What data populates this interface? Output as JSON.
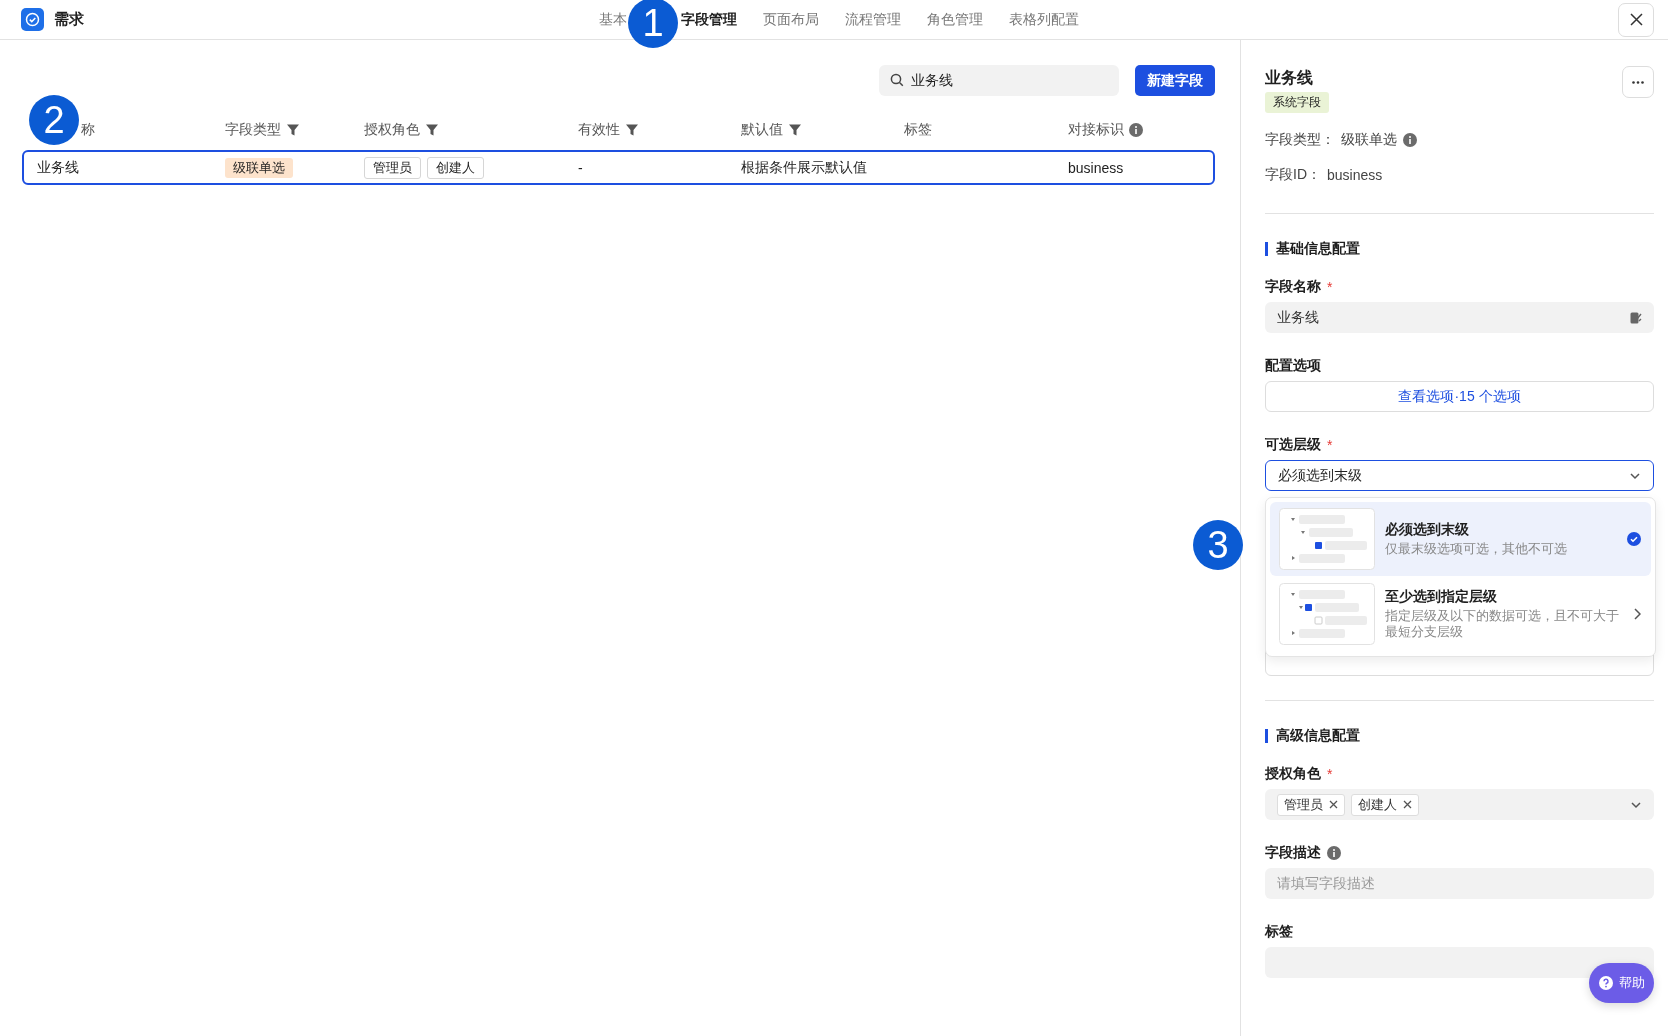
{
  "app": {
    "title": "需求"
  },
  "tabs": [
    {
      "label": "基本",
      "selected": false
    },
    {
      "label": "字段管理",
      "selected": true
    },
    {
      "label": "页面布局",
      "selected": false
    },
    {
      "label": "流程管理",
      "selected": false
    },
    {
      "label": "角色管理",
      "selected": false
    },
    {
      "label": "表格列配置",
      "selected": false
    }
  ],
  "annotations": [
    "1",
    "2",
    "3"
  ],
  "search": {
    "value": "业务线"
  },
  "new_button": "新建字段",
  "table": {
    "columns": [
      {
        "label": "称",
        "kind": "plain"
      },
      {
        "label": "字段类型",
        "kind": "filter"
      },
      {
        "label": "授权角色",
        "kind": "filter"
      },
      {
        "label": "有效性",
        "kind": "filter"
      },
      {
        "label": "默认值",
        "kind": "filter"
      },
      {
        "label": "标签",
        "kind": "plain"
      },
      {
        "label": "对接标识",
        "kind": "info"
      }
    ],
    "rows": [
      {
        "name": "业务线",
        "type": "级联单选",
        "roles": [
          "管理员",
          "创建人"
        ],
        "validity": "-",
        "default": "根据条件展示默认值",
        "key": "business",
        "selected": true
      }
    ]
  },
  "detail": {
    "title": "业务线",
    "badge": "系统字段",
    "type_label": "字段类型：",
    "type_value": "级联单选",
    "id_label": "字段ID：",
    "id_value": "business",
    "basic_section": "基础信息配置",
    "name_label": "字段名称",
    "name_required_mark": "*",
    "name_value": "业务线",
    "options_label": "配置选项",
    "options_button": "查看选项·15 个选项",
    "level_label": "可选层级",
    "level_required_mark": "*",
    "level_value": "必须选到末级",
    "level_options": [
      {
        "title": "必须选到末级",
        "desc": "仅最末级选项可选，其他不可选",
        "selected": true,
        "expandable": false
      },
      {
        "title": "至少选到指定层级",
        "desc": "指定层级及以下的数据可选，且不可大于最短分支层级",
        "selected": false,
        "expandable": true
      }
    ],
    "advanced_section": "高级信息配置",
    "roles_label": "授权角色",
    "roles_required_mark": "*",
    "roles": [
      "管理员",
      "创建人"
    ],
    "desc_label": "字段描述",
    "desc_placeholder": "请填写字段描述",
    "tags_label": "标签"
  },
  "help_button": "帮助"
}
